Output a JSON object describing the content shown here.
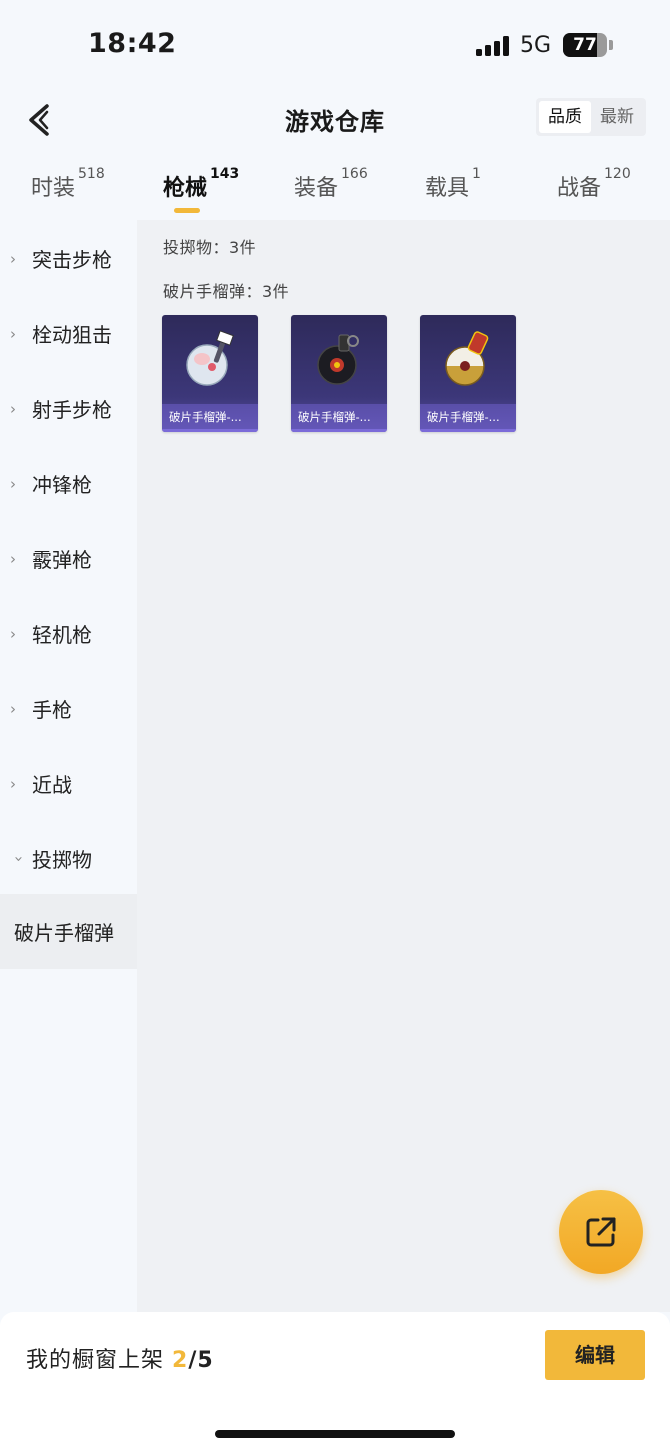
{
  "status": {
    "time": "18:42",
    "network": "5G",
    "battery": "77"
  },
  "header": {
    "title": "游戏仓库",
    "sort": [
      "品质",
      "最新"
    ],
    "sort_active": 0
  },
  "tabs": [
    {
      "label": "时装",
      "count": "518"
    },
    {
      "label": "枪械",
      "count": "143"
    },
    {
      "label": "装备",
      "count": "166"
    },
    {
      "label": "载具",
      "count": "1"
    },
    {
      "label": "战备",
      "count": "120"
    }
  ],
  "active_tab": 1,
  "sidebar": {
    "items": [
      "突击步枪",
      "栓动狙击",
      "射手步枪",
      "冲锋枪",
      "霰弹枪",
      "轻机枪",
      "手枪",
      "近战",
      "投掷物"
    ],
    "expanded_item": "投掷物",
    "sub_item": "破片手榴弹"
  },
  "content": {
    "category_label": "投掷物：3件",
    "group_label": "破片手榴弹：3件",
    "items": [
      "破片手榴弹-...",
      "破片手榴弹-...",
      "破片手榴弹-..."
    ]
  },
  "footer": {
    "showcase_label": "我的橱窗上架",
    "current": "2",
    "total": "/5",
    "edit_label": "编辑"
  },
  "colors": {
    "accent": "#f2b83a",
    "card_bg": "#3c3779",
    "content_bg": "#eff1f4"
  },
  "icons": [
    "back-icon",
    "share-icon",
    "chevron-right-icon",
    "chevron-down-icon"
  ]
}
